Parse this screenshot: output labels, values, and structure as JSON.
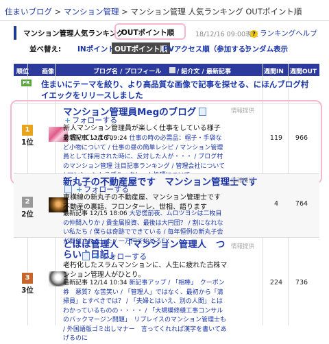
{
  "breadcrumb": {
    "items": [
      "住まいブログ",
      "マンション管理",
      "マンション管理 人気ランキング",
      "OUTポイント順"
    ],
    "sep": ">"
  },
  "title": {
    "label": "マンション管理人気ランキング",
    "selected": "OUTポイント順",
    "timestamp": "18/12/16 09:00現在",
    "help": "ランキングヘルプ",
    "help_glyph": "?"
  },
  "sort": {
    "label": "並べ替え:",
    "options": [
      "INポイント順",
      "OUTポイント順",
      "PVアクセス順（参加する）",
      "ランダム表示"
    ]
  },
  "table_header": {
    "rank": "順位",
    "image": "画像",
    "blog": "ブログ名 / プロフィール",
    "intro": "/ 紹介文 / 最新記事",
    "in": "週間IN",
    "out": "週間OUT"
  },
  "notice": {
    "badge": "PR",
    "text": "住まいにテーマを絞り、より高品質な画像で記事を探せる、にほんブログ村イエックをリリースしました"
  },
  "rows": [
    {
      "rank": "1位",
      "badge": "1",
      "title": "マンション管理員Megのブログ",
      "info": "情報提供",
      "follow": "フォローする",
      "desc": "新人マンション管理員が楽しく仕事をしている様子を書いています。",
      "latest_label": "最新記事",
      "latest_time": "12/16 09:24",
      "latest": "仕事の時の必需品：帽子・手袋など小物について / 仕事の昼の簡単レシピ / マンション管理員として採用された時に、反対した人が・・・ / ブログ村のマンション管理 注目記事ランキング / 管理会社について / マンショントラブル・クレーム処理について",
      "in": "119",
      "out": "966"
    },
    {
      "rank": "2位",
      "badge": "2",
      "title": "新丸子の不動産屋です　マンション管理士です",
      "info": "情報提供",
      "follow": "フォローする",
      "desc": "東横線の新丸子の不動産屋、マンション管理士です 不動産の裏話、フロンターレ、世相、語ります",
      "latest_label": "最新記事",
      "latest_time": "12/15 18:06",
      "latest": "大恐慌前夜、ムロツヨシは二枚目の仲間入りか / 貴金属投資、最後は大円団？ / 割になれない私たち / 僕らは奇跡でできている / 毎年恒例の新丸子会が開催されました / 一万円で始めるFX",
      "in": "4",
      "out": "764"
    },
    {
      "rank": "3位",
      "badge": "3",
      "title": "とほほ管理人　「マンション管理人　つらいよ日記」",
      "info": "情報提供",
      "follow": "フォローする",
      "desc": "老朽化したスラムマンションに、人生に疲れた古株マンション管理人がひとり。",
      "latest_label": "最新記事",
      "latest_time": "12/14 10:34",
      "latest": "新記事アップ / 「相棒」　クーポン券　悪質？な苦笑い / 「管理人」ではなく、最初から「清掃員」とすべきでは？ / 「夫婦とはいえ、別の人間」とはわかっているものの・・・・ / 「大規模修繕工事コンサルのバックマージン問題」　リプレイスのマンション管理士も / 外国語版ゴミ出しマナー　言ってくれれば漢字を書いてあげるのに",
      "in": "224",
      "out": "736"
    }
  ],
  "colors": {
    "header_bg": "#2b3a9c",
    "link": "#1a35a8",
    "highlight": "#f4b6d0",
    "gold": "#e8a41c",
    "silver": "#999999",
    "bronze": "#c8652c"
  }
}
